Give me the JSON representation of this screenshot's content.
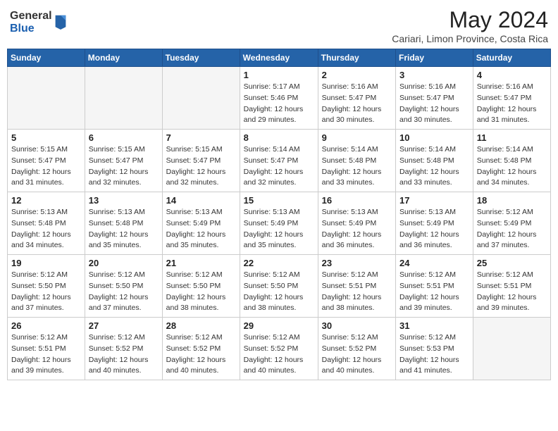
{
  "header": {
    "logo_general": "General",
    "logo_blue": "Blue",
    "month_year": "May 2024",
    "location": "Cariari, Limon Province, Costa Rica"
  },
  "weekdays": [
    "Sunday",
    "Monday",
    "Tuesday",
    "Wednesday",
    "Thursday",
    "Friday",
    "Saturday"
  ],
  "weeks": [
    [
      {
        "day": "",
        "info": ""
      },
      {
        "day": "",
        "info": ""
      },
      {
        "day": "",
        "info": ""
      },
      {
        "day": "1",
        "info": "Sunrise: 5:17 AM\nSunset: 5:46 PM\nDaylight: 12 hours\nand 29 minutes."
      },
      {
        "day": "2",
        "info": "Sunrise: 5:16 AM\nSunset: 5:47 PM\nDaylight: 12 hours\nand 30 minutes."
      },
      {
        "day": "3",
        "info": "Sunrise: 5:16 AM\nSunset: 5:47 PM\nDaylight: 12 hours\nand 30 minutes."
      },
      {
        "day": "4",
        "info": "Sunrise: 5:16 AM\nSunset: 5:47 PM\nDaylight: 12 hours\nand 31 minutes."
      }
    ],
    [
      {
        "day": "5",
        "info": "Sunrise: 5:15 AM\nSunset: 5:47 PM\nDaylight: 12 hours\nand 31 minutes."
      },
      {
        "day": "6",
        "info": "Sunrise: 5:15 AM\nSunset: 5:47 PM\nDaylight: 12 hours\nand 32 minutes."
      },
      {
        "day": "7",
        "info": "Sunrise: 5:15 AM\nSunset: 5:47 PM\nDaylight: 12 hours\nand 32 minutes."
      },
      {
        "day": "8",
        "info": "Sunrise: 5:14 AM\nSunset: 5:47 PM\nDaylight: 12 hours\nand 32 minutes."
      },
      {
        "day": "9",
        "info": "Sunrise: 5:14 AM\nSunset: 5:48 PM\nDaylight: 12 hours\nand 33 minutes."
      },
      {
        "day": "10",
        "info": "Sunrise: 5:14 AM\nSunset: 5:48 PM\nDaylight: 12 hours\nand 33 minutes."
      },
      {
        "day": "11",
        "info": "Sunrise: 5:14 AM\nSunset: 5:48 PM\nDaylight: 12 hours\nand 34 minutes."
      }
    ],
    [
      {
        "day": "12",
        "info": "Sunrise: 5:13 AM\nSunset: 5:48 PM\nDaylight: 12 hours\nand 34 minutes."
      },
      {
        "day": "13",
        "info": "Sunrise: 5:13 AM\nSunset: 5:48 PM\nDaylight: 12 hours\nand 35 minutes."
      },
      {
        "day": "14",
        "info": "Sunrise: 5:13 AM\nSunset: 5:49 PM\nDaylight: 12 hours\nand 35 minutes."
      },
      {
        "day": "15",
        "info": "Sunrise: 5:13 AM\nSunset: 5:49 PM\nDaylight: 12 hours\nand 35 minutes."
      },
      {
        "day": "16",
        "info": "Sunrise: 5:13 AM\nSunset: 5:49 PM\nDaylight: 12 hours\nand 36 minutes."
      },
      {
        "day": "17",
        "info": "Sunrise: 5:13 AM\nSunset: 5:49 PM\nDaylight: 12 hours\nand 36 minutes."
      },
      {
        "day": "18",
        "info": "Sunrise: 5:12 AM\nSunset: 5:49 PM\nDaylight: 12 hours\nand 37 minutes."
      }
    ],
    [
      {
        "day": "19",
        "info": "Sunrise: 5:12 AM\nSunset: 5:50 PM\nDaylight: 12 hours\nand 37 minutes."
      },
      {
        "day": "20",
        "info": "Sunrise: 5:12 AM\nSunset: 5:50 PM\nDaylight: 12 hours\nand 37 minutes."
      },
      {
        "day": "21",
        "info": "Sunrise: 5:12 AM\nSunset: 5:50 PM\nDaylight: 12 hours\nand 38 minutes."
      },
      {
        "day": "22",
        "info": "Sunrise: 5:12 AM\nSunset: 5:50 PM\nDaylight: 12 hours\nand 38 minutes."
      },
      {
        "day": "23",
        "info": "Sunrise: 5:12 AM\nSunset: 5:51 PM\nDaylight: 12 hours\nand 38 minutes."
      },
      {
        "day": "24",
        "info": "Sunrise: 5:12 AM\nSunset: 5:51 PM\nDaylight: 12 hours\nand 39 minutes."
      },
      {
        "day": "25",
        "info": "Sunrise: 5:12 AM\nSunset: 5:51 PM\nDaylight: 12 hours\nand 39 minutes."
      }
    ],
    [
      {
        "day": "26",
        "info": "Sunrise: 5:12 AM\nSunset: 5:51 PM\nDaylight: 12 hours\nand 39 minutes."
      },
      {
        "day": "27",
        "info": "Sunrise: 5:12 AM\nSunset: 5:52 PM\nDaylight: 12 hours\nand 40 minutes."
      },
      {
        "day": "28",
        "info": "Sunrise: 5:12 AM\nSunset: 5:52 PM\nDaylight: 12 hours\nand 40 minutes."
      },
      {
        "day": "29",
        "info": "Sunrise: 5:12 AM\nSunset: 5:52 PM\nDaylight: 12 hours\nand 40 minutes."
      },
      {
        "day": "30",
        "info": "Sunrise: 5:12 AM\nSunset: 5:52 PM\nDaylight: 12 hours\nand 40 minutes."
      },
      {
        "day": "31",
        "info": "Sunrise: 5:12 AM\nSunset: 5:53 PM\nDaylight: 12 hours\nand 41 minutes."
      },
      {
        "day": "",
        "info": ""
      }
    ]
  ]
}
